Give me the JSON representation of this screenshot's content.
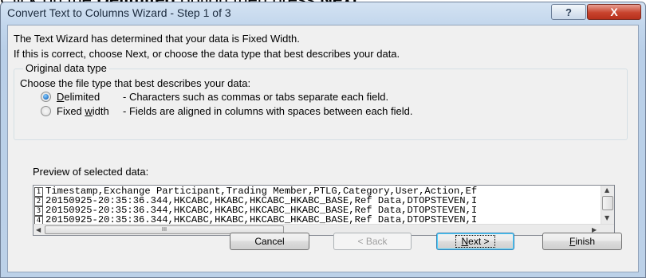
{
  "caption": {
    "prefix": "Click on the ",
    "bold1": "Delimited",
    "middle": " option then press ",
    "bold2": "Next"
  },
  "window": {
    "title": "Convert Text to Columns Wizard - Step 1 of 3",
    "help_label": "?",
    "close_label": "X"
  },
  "intro": {
    "line1": "The Text Wizard has determined that your data is Fixed Width.",
    "line2": "If this is correct, choose Next, or choose the data type that best describes your data."
  },
  "group": {
    "legend": "Original data type",
    "prompt": "Choose the file type that best describes your data:",
    "options": [
      {
        "label_pre": "",
        "label_u": "D",
        "label_post": "elimited",
        "desc": "- Characters such as commas or tabs separate each field.",
        "selected": true
      },
      {
        "label_pre": "Fixed ",
        "label_u": "w",
        "label_post": "idth",
        "desc": "- Fields are aligned in columns with spaces between each field.",
        "selected": false
      }
    ]
  },
  "preview": {
    "label": "Preview of selected data:",
    "row_numbers": [
      "1",
      "2",
      "3",
      "4"
    ],
    "lines": [
      "Timestamp,Exchange Participant,Trading Member,PTLG,Category,User,Action,Ef",
      "20150925-20:35:36.344,HKCABC,HKABC,HKCABC_HKABC_BASE,Ref Data,DTOPSTEVEN,I",
      "20150925-20:35:36.344,HKCABC,HKABC,HKCABC_HKABC_BASE,Ref Data,DTOPSTEVEN,I",
      "20150925-20:35:36.344,HKCABC,HKABC,HKCABC_HKABC_BASE,Ref Data,DTOPSTEVEN,I"
    ],
    "hthumb_grip": "III"
  },
  "buttons": {
    "cancel": "Cancel",
    "back": "< Back",
    "next_u": "N",
    "next_rest": "ext >",
    "finish_u": "F",
    "finish_rest": "inish"
  }
}
